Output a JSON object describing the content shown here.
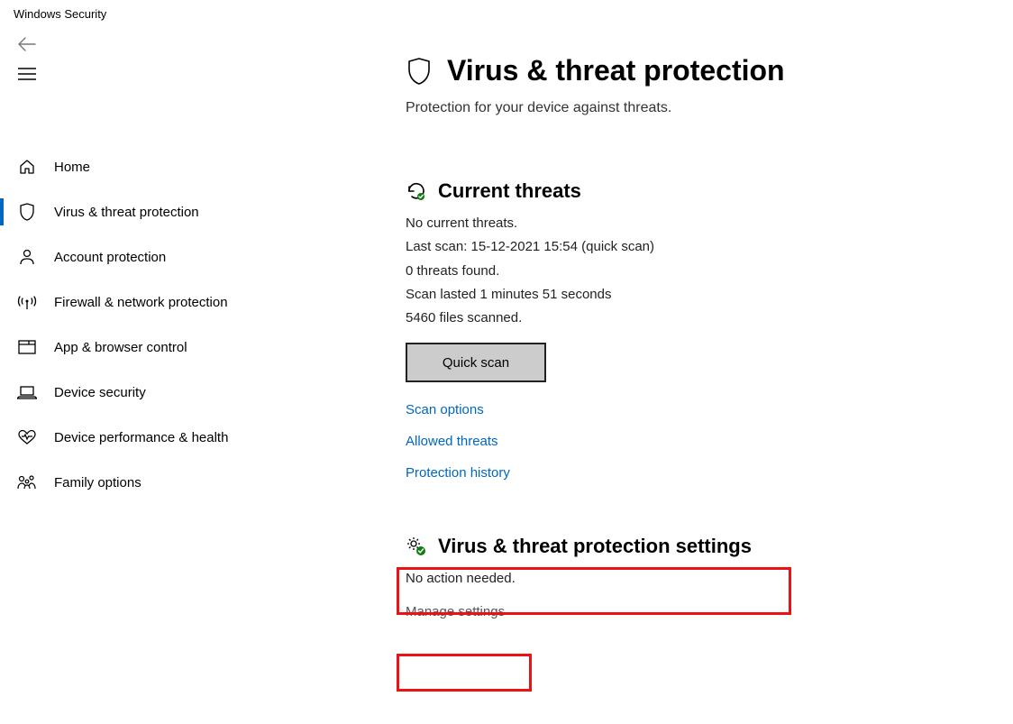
{
  "app_title": "Windows Security",
  "sidebar": {
    "items": [
      {
        "label": "Home"
      },
      {
        "label": "Virus & threat protection"
      },
      {
        "label": "Account protection"
      },
      {
        "label": "Firewall & network protection"
      },
      {
        "label": "App & browser control"
      },
      {
        "label": "Device security"
      },
      {
        "label": "Device performance & health"
      },
      {
        "label": "Family options"
      }
    ]
  },
  "page": {
    "title": "Virus & threat protection",
    "subtitle": "Protection for your device against threats."
  },
  "current_threats": {
    "heading": "Current threats",
    "line1": "No current threats.",
    "line2": "Last scan: 15-12-2021 15:54 (quick scan)",
    "line3": "0 threats found.",
    "line4": "Scan lasted 1 minutes 51 seconds",
    "line5": "5460 files scanned.",
    "quick_scan_btn": "Quick scan",
    "scan_options_link": "Scan options",
    "allowed_threats_link": "Allowed threats",
    "protection_history_link": "Protection history"
  },
  "settings_section": {
    "heading": "Virus & threat protection settings",
    "status": "No action needed.",
    "manage_link": "Manage settings"
  }
}
